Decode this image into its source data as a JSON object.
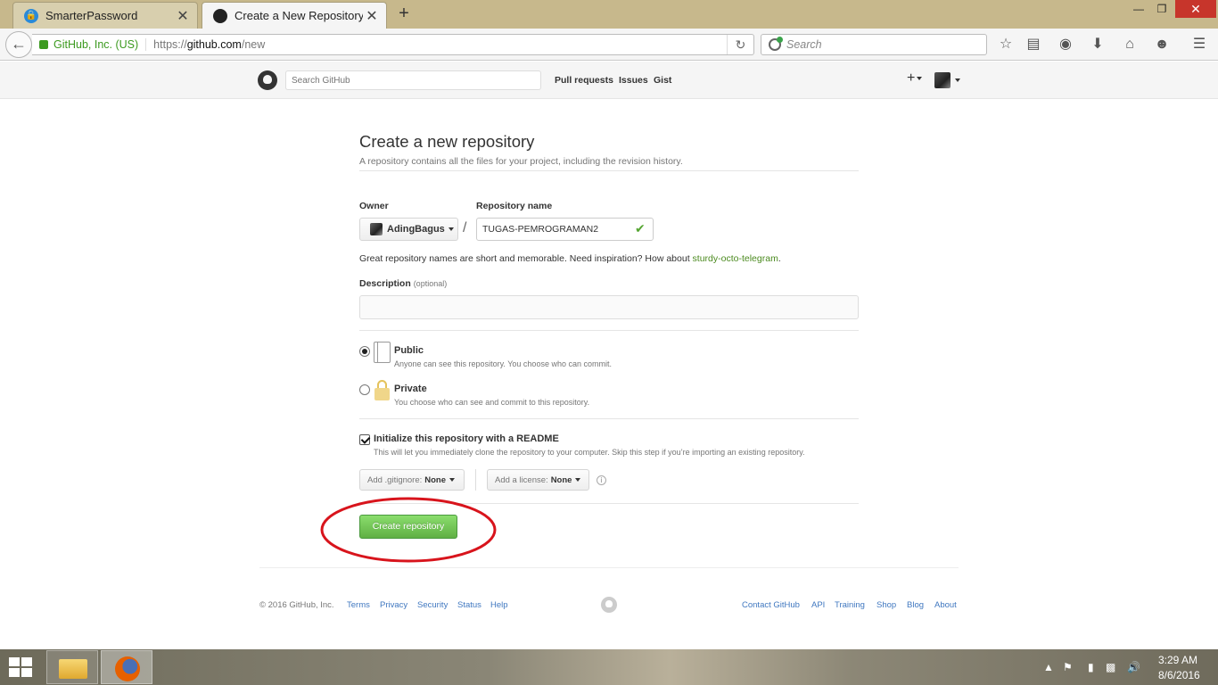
{
  "browser": {
    "tabs": [
      {
        "label": "SmarterPassword",
        "icon": "lock-icon",
        "active": false
      },
      {
        "label": "Create a New Repository",
        "icon": "github-icon",
        "active": true
      }
    ],
    "new_tab": "+",
    "url_identity": "GitHub, Inc. (US)",
    "url_prefix": "https://",
    "url_host": "github.com",
    "url_path": "/new",
    "search_placeholder": "Search"
  },
  "github_header": {
    "search_placeholder": "Search GitHub",
    "nav": [
      "Pull requests",
      "Issues",
      "Gist"
    ],
    "plus": "+"
  },
  "form": {
    "title": "Create a new repository",
    "subtitle": "A repository contains all the files for your project, including the revision history.",
    "owner_label": "Owner",
    "owner_value": "AdingBagus",
    "separator": "/",
    "repo_label": "Repository name",
    "repo_value": "TUGAS-PEMROGRAMAN2",
    "hint_prefix": "Great repository names are short and memorable. Need inspiration? How about ",
    "hint_suggestion": "sturdy-octo-telegram",
    "hint_suffix": ".",
    "description_label": "Description",
    "description_optional": "(optional)",
    "description_value": "",
    "visibility": [
      {
        "title": "Public",
        "desc": "Anyone can see this repository. You choose who can commit.",
        "selected": true
      },
      {
        "title": "Private",
        "desc": "You choose who can see and commit to this repository.",
        "selected": false
      }
    ],
    "readme_title": "Initialize this repository with a README",
    "readme_desc": "This will let you immediately clone the repository to your computer. Skip this step if you’re importing an existing repository.",
    "readme_checked": true,
    "gitignore_label": "Add .gitignore:",
    "gitignore_value": "None",
    "license_label": "Add a license:",
    "license_value": "None",
    "info": "i",
    "create_button": "Create repository"
  },
  "footer": {
    "copyright": "© 2016 GitHub, Inc.",
    "left_links": [
      "Terms",
      "Privacy",
      "Security",
      "Status",
      "Help"
    ],
    "right_links": [
      "Contact GitHub",
      "API",
      "Training",
      "Shop",
      "Blog",
      "About"
    ]
  },
  "taskbar": {
    "time": "3:29 AM",
    "date": "8/6/2016"
  },
  "colors": {
    "accent_green": "#60b044",
    "link_blue": "#4078c0",
    "annotation_red": "#d8141c",
    "close_red": "#c7352b"
  }
}
